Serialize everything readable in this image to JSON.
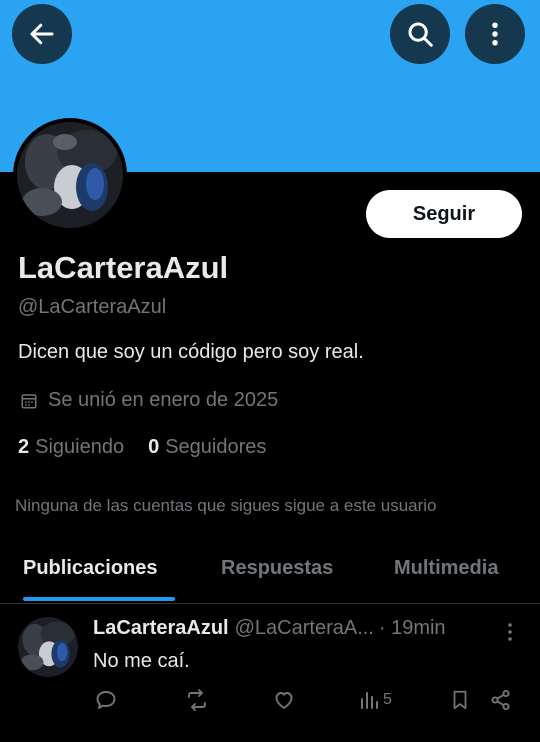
{
  "header": {
    "banner_color": "#2aa3f2",
    "back_icon": "arrow-left-icon",
    "search_icon": "search-icon",
    "more_icon": "more-vertical-icon"
  },
  "profile": {
    "display_name": "LaCarteraAzul",
    "handle": "@LaCarteraAzul",
    "bio": "Dicen que soy un código pero soy real.",
    "joined": "Se unió en enero de 2025",
    "following_count": "2",
    "following_label": "Siguiendo",
    "followers_count": "0",
    "followers_label": "Seguidores",
    "follow_button": "Seguir",
    "mutual_note": "Ninguna de las cuentas que sigues sigue a este usuario"
  },
  "tabs": [
    {
      "label": "Publicaciones",
      "active": true
    },
    {
      "label": "Respuestas",
      "active": false
    },
    {
      "label": "Multimedia",
      "active": false
    }
  ],
  "post": {
    "name": "LaCarteraAzul",
    "handle": "@LaCarteraA...",
    "time": "· 19min",
    "text": "No me caí.",
    "views": "5"
  },
  "colors": {
    "accent": "#1d9bf0",
    "text_primary": "#e7e9ea",
    "text_secondary": "#71767b",
    "background": "#000000"
  }
}
